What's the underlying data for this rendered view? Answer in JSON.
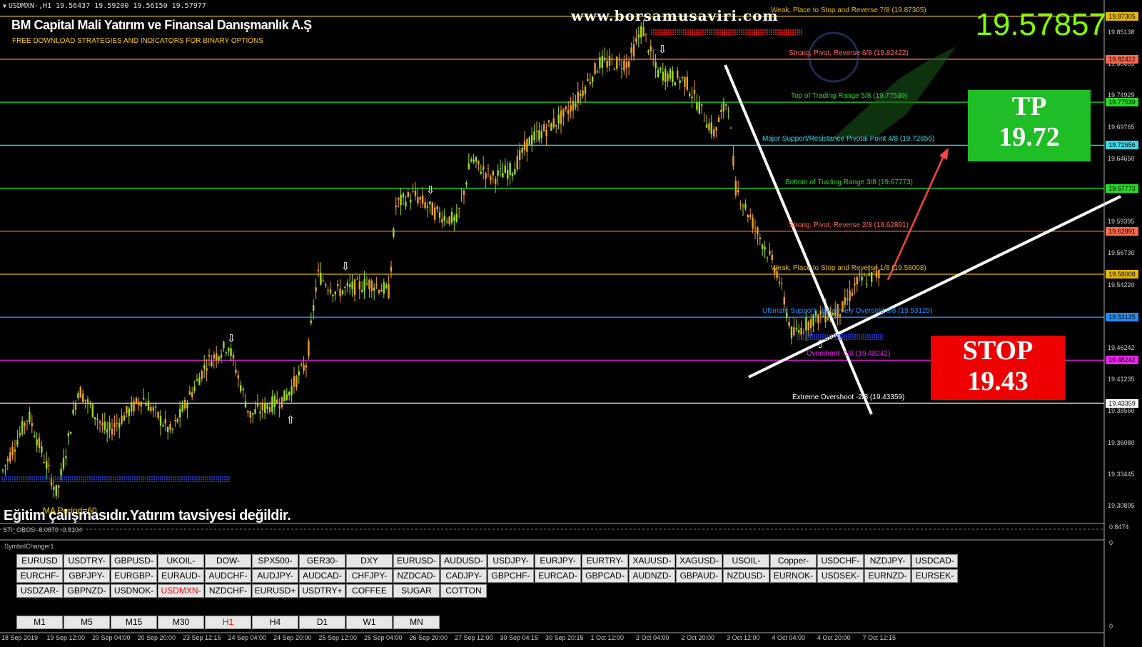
{
  "window": {
    "symbol_header": "USDMXN-,H1  19.56437 19.59200 19.56150 19.57977",
    "company": "BM Capital Mali Yatırım ve Finansal Danışmanlık A.Ş",
    "tagline": "FREE DOWNLOAD STRATEGIES AND INDICATORS FOR BINARY OPTIONS",
    "website": "www.borsamusaviri.com",
    "current_price": "19.57857",
    "disclaimer": "Eğitim çalışmasıdır.Yatırım tavsiyesi değildir.",
    "ma_label": "MA Period=60"
  },
  "targets": {
    "tp_label": "TP",
    "tp_value": "19.72",
    "stop_label": "STOP",
    "stop_value": "19.43"
  },
  "levels": [
    {
      "text": "Weak, Place to Stop and Reverse  7/8  (19.87305)",
      "price": 19.87305,
      "color": "#e6b800",
      "badge": "19.87305"
    },
    {
      "text": "Strong, Pivot, Reverse  6/8  (19.82422)",
      "price": 19.82422,
      "color": "#ff6a4d",
      "badge": "19.82422"
    },
    {
      "text": "Top of Trading Range  5/8  (19.77539)",
      "price": 19.77539,
      "color": "#22dd22",
      "badge": "19.77539"
    },
    {
      "text": "Major Support/Resistance Pivotal Point  4/8  (19.72656)",
      "price": 19.72656,
      "color": "#33ddee",
      "badge": "19.72656"
    },
    {
      "text": "Bottom of Trading Range  3/8  (19.67773)",
      "price": 19.67773,
      "color": "#22dd22",
      "badge": "19.67773"
    },
    {
      "text": "Strong, Pivot, Reverse  2/8  (19.62891)",
      "price": 19.62891,
      "color": "#ff6a4d",
      "badge": "19.62891"
    },
    {
      "text": "Weak, Place to Stop and Reverse  1/8  (19.58008)",
      "price": 19.58008,
      "color": "#e6b800",
      "badge": "19.58008"
    },
    {
      "text": "Ultimate Support - Extremely Oversold  0/8  (19.53125)",
      "price": 19.53125,
      "color": "#1e90ff",
      "badge": "19.53125"
    },
    {
      "text": "Overshoot  -1/8  (19.48242)",
      "price": 19.48242,
      "color": "#ee22ee",
      "badge": "19.48242"
    },
    {
      "text": "Extreme Overshoot  -2/8  (19.43359)",
      "price": 19.43359,
      "color": "#ffffff",
      "badge": "19.43359"
    }
  ],
  "price_axis": {
    "min": 19.297,
    "max": 19.885,
    "ticks": [
      "19.85138",
      "19.80095",
      "19.74929",
      "19.69765",
      "19.64650",
      "19.61035",
      "19.59395",
      "19.56730",
      "19.54220",
      "19.51595",
      "19.46242",
      "19.41235",
      "19.38560",
      "19.36080",
      "19.33445",
      "19.30895"
    ]
  },
  "subwindow": {
    "indicator": "STI_OBOS -8.0870 -0.8104",
    "right_top": "0.8474",
    "right_mid": "0",
    "right_bottom": "0",
    "panel_label": "SymbolChanger1"
  },
  "symbols": [
    [
      "EURUSD",
      "USDTRY-",
      "GBPUSD-",
      "UKOIL-",
      "DOW-",
      "SPX500-",
      "GER30-",
      "DXY",
      "EURUSD-",
      "AUDUSD-",
      "USDJPY-",
      "EURJPY-",
      "EURTRY-",
      "XAUUSD-",
      "XAGUSD-",
      "USOIL-",
      "Copper-",
      "USDCHF-",
      "NZDJPY-",
      "USDCAD-"
    ],
    [
      "EURCHF-",
      "GBPJPY-",
      "EURGBP-",
      "EURAUD-",
      "AUDCHF-",
      "AUDJPY-",
      "AUDCAD-",
      "CHFJPY-",
      "NZDCAD-",
      "CADJPY-",
      "GBPCHF-",
      "EURCAD-",
      "GBPCAD-",
      "AUDNZD-",
      "GBPAUD-",
      "NZDUSD-",
      "EURNOK-",
      "USDSEK-",
      "EURNZD-",
      "EURSEK-"
    ],
    [
      "USDZAR-",
      "GBPNZD-",
      "USDNOK-",
      "USDMXN-",
      "NZDCHF-",
      "EURUSD+",
      "USDTRY+",
      "COFFEE",
      "SUGAR",
      "COTTON"
    ]
  ],
  "active_symbol": "USDMXN-",
  "timeframes": [
    "M1",
    "M5",
    "M15",
    "M30",
    "H1",
    "H4",
    "D1",
    "W1",
    "MN"
  ],
  "active_timeframe": "H1",
  "time_axis": [
    "18 Sep 2019",
    "19 Sep 12:00",
    "20 Sep 04:00",
    "20 Sep 20:00",
    "23 Sep 12:15",
    "24 Sep 04:00",
    "24 Sep 20:00",
    "25 Sep 12:00",
    "26 Sep 04:00",
    "26 Sep 20:00",
    "27 Sep 12:00",
    "30 Sep 04:15",
    "30 Sep 20:15",
    "1 Oct 12:00",
    "2 Oct 04:00",
    "2 Oct 20:00",
    "3 Oct 12:00",
    "4 Oct 04:00",
    "4 Oct 20:00",
    "7 Oct 12:15"
  ],
  "colors": {
    "bull": "#9adf1a",
    "bear": "#f0a020",
    "wedge": "#ffffff",
    "target_arrow": "#ff4444"
  }
}
